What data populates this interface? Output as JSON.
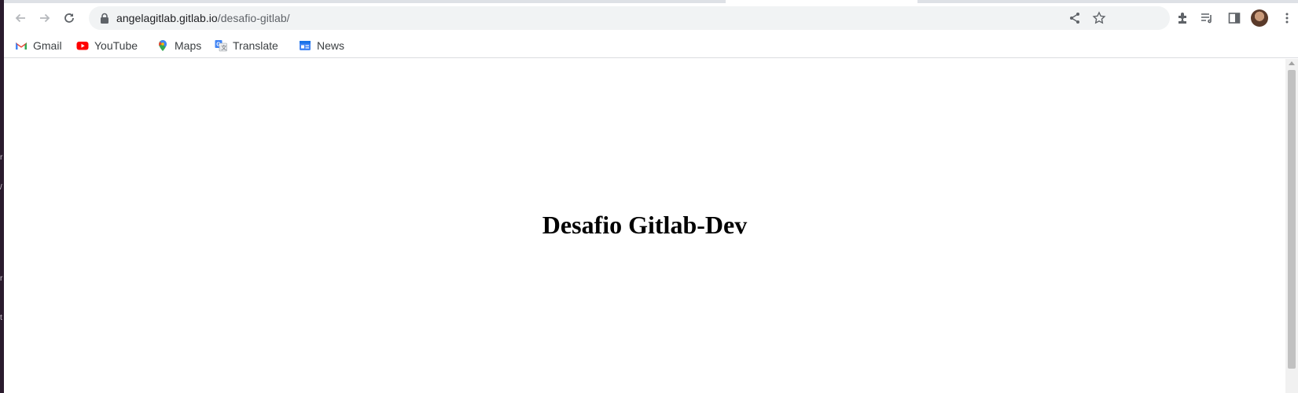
{
  "browser": {
    "url_host": "angelagitlab.gitlab.io",
    "url_path": "/desafio-gitlab/",
    "bookmarks": [
      {
        "label": "Gmail",
        "icon": "gmail-icon"
      },
      {
        "label": "YouTube",
        "icon": "youtube-icon"
      },
      {
        "label": "Maps",
        "icon": "maps-icon"
      },
      {
        "label": "Translate",
        "icon": "translate-icon"
      },
      {
        "label": "News",
        "icon": "news-icon"
      }
    ],
    "toolbar_icons": [
      "back-icon",
      "forward-icon",
      "reload-icon",
      "lock-icon",
      "share-icon",
      "star-icon",
      "extensions-icon",
      "reading-list-icon",
      "side-panel-icon",
      "avatar",
      "menu-icon"
    ]
  },
  "page": {
    "heading": "Desafio Gitlab-Dev"
  },
  "colors": {
    "accent_gmail_red": "#ea4335",
    "youtube_red": "#ff0000",
    "news_blue": "#4285f4"
  }
}
